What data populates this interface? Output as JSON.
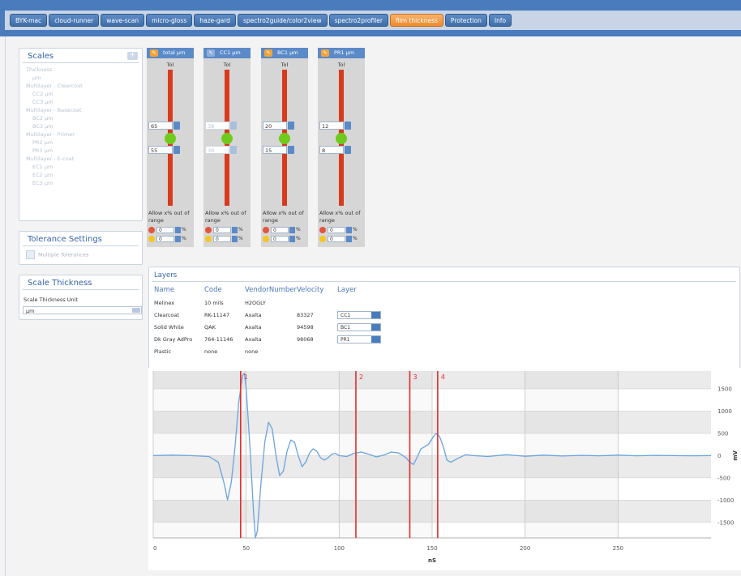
{
  "nav": {
    "tabs": [
      "BYK-mac",
      "cloud-runner",
      "wave-scan",
      "micro-gloss",
      "haze-gard",
      "spectro2guide/color2view",
      "spectro2profiler",
      "film thickness",
      "Protection",
      "Info"
    ],
    "active": "film thickness"
  },
  "scales": {
    "title": "Scales",
    "add_label": "+",
    "items": [
      {
        "label": "Thickness",
        "sub": false
      },
      {
        "label": "μm",
        "sub": true
      },
      {
        "label": "Multilayer - Clearcoat",
        "sub": false
      },
      {
        "label": "CC2 μm",
        "sub": true
      },
      {
        "label": "CC3 μm",
        "sub": true
      },
      {
        "label": "Multilayer - Basecoat",
        "sub": false
      },
      {
        "label": "BC2 μm",
        "sub": true
      },
      {
        "label": "BC3 μm",
        "sub": true
      },
      {
        "label": "Multilayer - Primer",
        "sub": false
      },
      {
        "label": "PR2 μm",
        "sub": true
      },
      {
        "label": "PR3 μm",
        "sub": true
      },
      {
        "label": "Multilayer - E-coat",
        "sub": false
      },
      {
        "label": "EC1 μm",
        "sub": true
      },
      {
        "label": "EC2 μm",
        "sub": true
      },
      {
        "label": "EC3 μm",
        "sub": true
      }
    ]
  },
  "tolerance": {
    "title": "Tolerance Settings",
    "multiple_label": "Multiple Tolerances"
  },
  "scale_thickness": {
    "title": "Scale Thickness",
    "unit_label": "Scale Thickness Unit",
    "unit_value": "μm"
  },
  "sliders": [
    {
      "title": "total μm",
      "tol": "Tol",
      "upper": "65",
      "lower": "55",
      "enabled": true,
      "allow": "Allow x% out of range",
      "red": "0",
      "yellow": "0",
      "pct": "%"
    },
    {
      "title": "CC1 μm",
      "tol": "Tol",
      "upper": "38",
      "lower": "30",
      "enabled": false,
      "allow": "Allow x% out of range",
      "red": "0",
      "yellow": "0",
      "pct": "%"
    },
    {
      "title": "BC1 μm",
      "tol": "Tol",
      "upper": "20",
      "lower": "15",
      "enabled": true,
      "allow": "Allow x% out of range",
      "red": "0",
      "yellow": "0",
      "pct": "%"
    },
    {
      "title": "PR1 μm",
      "tol": "Tol",
      "upper": "12",
      "lower": "8",
      "enabled": true,
      "allow": "Allow x% out of range",
      "red": "0",
      "yellow": "0",
      "pct": "%"
    }
  ],
  "layers": {
    "title": "Layers",
    "headers": [
      "Name",
      "Code",
      "VendorNumber",
      "Velocity",
      "Layer"
    ],
    "rows": [
      {
        "name": "Melinex",
        "code": "10 mils",
        "vendor": "H2OGLY",
        "velocity": "",
        "layer": ""
      },
      {
        "name": "Clearcoat",
        "code": "RK-11147",
        "vendor": "Axalta",
        "velocity": "83327",
        "layer": "CC1"
      },
      {
        "name": "Solid White",
        "code": "QAK",
        "vendor": "Axalta",
        "velocity": "94598",
        "layer": "BC1"
      },
      {
        "name": "Dk Gray AdPro",
        "code": "764-11146",
        "vendor": "Axalta",
        "velocity": "98068",
        "layer": "PR1"
      },
      {
        "name": "Plastic",
        "code": "none",
        "vendor": "none",
        "velocity": "",
        "layer": ""
      }
    ]
  },
  "chart_data": {
    "type": "line",
    "xlabel": "nS",
    "ylabel": "mV",
    "xlim": [
      0,
      300
    ],
    "ylim": [
      -1850,
      1900
    ],
    "x_ticks": [
      0,
      50,
      100,
      150,
      200,
      250
    ],
    "y_ticks": [
      1500,
      1000,
      500,
      0,
      -500,
      -1000,
      -1500
    ],
    "series": [
      {
        "color": "#6aa3e0",
        "x": [
          0,
          10,
          20,
          30,
          35,
          38,
          40,
          42,
          44,
          46,
          48,
          49,
          50,
          52,
          54,
          55,
          56,
          58,
          60,
          62,
          64,
          66,
          68,
          70,
          72,
          74,
          76,
          78,
          80,
          82,
          84,
          86,
          88,
          90,
          92,
          94,
          96,
          98,
          100,
          104,
          108,
          112,
          116,
          120,
          124,
          128,
          132,
          136,
          138,
          140,
          142,
          144,
          146,
          148,
          150,
          152,
          154,
          156,
          158,
          160,
          164,
          168,
          172,
          180,
          190,
          200,
          210,
          220,
          230,
          240,
          250,
          260,
          270,
          280,
          290,
          300
        ],
        "y": [
          0,
          10,
          0,
          -20,
          -150,
          -600,
          -1000,
          -600,
          200,
          1200,
          1800,
          1850,
          1500,
          200,
          -1300,
          -1850,
          -1700,
          -600,
          300,
          750,
          600,
          0,
          -450,
          -350,
          100,
          350,
          300,
          0,
          -250,
          -150,
          50,
          150,
          100,
          -50,
          -100,
          -50,
          30,
          50,
          0,
          -20,
          50,
          80,
          30,
          -30,
          10,
          80,
          60,
          -50,
          -150,
          -200,
          -30,
          150,
          200,
          250,
          380,
          500,
          430,
          200,
          -100,
          -150,
          -60,
          20,
          0,
          -20,
          20,
          -15,
          10,
          -10,
          5,
          -5,
          10,
          -5,
          5,
          0,
          -5,
          0
        ]
      }
    ],
    "markers": [
      {
        "label": "1",
        "x": 47
      },
      {
        "label": "2",
        "x": 109
      },
      {
        "label": "3",
        "x": 138
      },
      {
        "label": "4",
        "x": 153
      }
    ],
    "grid": true
  }
}
